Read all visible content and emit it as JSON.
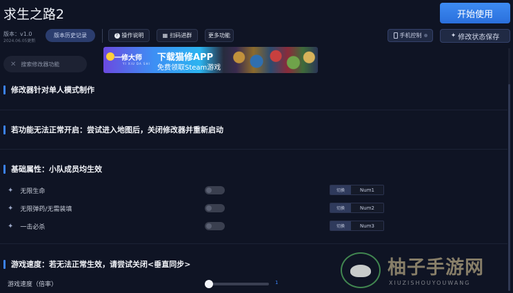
{
  "app": {
    "title": "求生之路2",
    "start_label": "开始使用",
    "version": "版本：v1.0",
    "version_date": "2024.06.05更新"
  },
  "toolbar": {
    "history_label": "版本历史记录",
    "help_label": "操作说明",
    "qr_label": "扫码进群",
    "more_label": "更多功能",
    "phone_label": "手机控制",
    "save_label": "修改状态保存"
  },
  "search": {
    "placeholder": "搜索修改器功能"
  },
  "banner": {
    "brand": "一修大师",
    "brand_sub": "YI XIU DA SHI",
    "headline": "下载猫修APP",
    "subline": "免费领取Steam游戏"
  },
  "sections": {
    "s1": "修改器针对单人模式制作",
    "s2": "若功能无法正常开启：尝试进入地图后，关闭修改器并重新启动",
    "s3": "基础属性：小队成员均生效",
    "s4": "游戏速度：若无法正常生效，请尝试关闭<垂直同步>"
  },
  "features": [
    {
      "label": "无限生命",
      "switch_label": "切换",
      "key": "Num1",
      "enabled": false
    },
    {
      "label": "无限弹药/无需装填",
      "switch_label": "切换",
      "key": "Num2",
      "enabled": false
    },
    {
      "label": "一击必杀",
      "switch_label": "切换",
      "key": "Num3",
      "enabled": false
    }
  ],
  "speed": {
    "label": "游戏速度（倍率）",
    "value": "1"
  },
  "watermark": {
    "text": "柚子手游网",
    "sub": "XIUZISHOUYOUWANG"
  },
  "colors": {
    "accent": "#3b82f6",
    "background": "#0f1424"
  }
}
